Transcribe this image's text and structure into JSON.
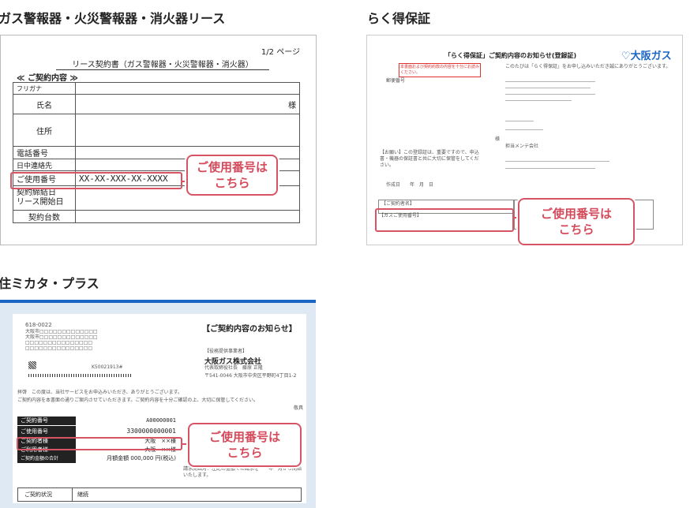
{
  "sections": {
    "gas": {
      "title": "ガス警報器・火災警報器・消火器リース",
      "page": "1/2 ページ",
      "doc_title": "リース契約書（ガス警報器・火災警報器・消火器）",
      "contract_heading": "≪ ご契約内容 ≫",
      "rows": [
        {
          "label": "フリガナ",
          "value": ""
        },
        {
          "label": "氏名",
          "value": "様"
        },
        {
          "label": "住所",
          "value": ""
        },
        {
          "label": "電話番号",
          "value": ""
        },
        {
          "label": "日中連絡先",
          "value": ""
        },
        {
          "label": "ご使用番号",
          "value": "XX-XX-XXX-XX-XXXX"
        },
        {
          "label": "契約締結日\nリース開始日",
          "value": ""
        },
        {
          "label": "契約台数",
          "value": ""
        }
      ],
      "callout": [
        "ご使用番号は",
        "こちら"
      ]
    },
    "raku": {
      "title": "らく得保証",
      "doc_title": "「らく得保証」ご契約内容のお知らせ(登録証)",
      "brand": "大阪ガス",
      "notice": "本書面および契約約款の内容を十分にお読みください。",
      "postal_label": "郵便番号",
      "body_text": "このたびは「らく得保証」をお申し込みいただき誠にありがとうございます。",
      "left_block": "【お願い】この登録証は、重要ですので、申込書・機器の保証書と共に大切に保管をしてください。",
      "date_label": "作成日　　年　月　日",
      "contractor_label": "【ご契約者名】",
      "usage_label": "【ガスご使用番号】",
      "sama": "様",
      "tanto": "担当メンテ会社",
      "callout": [
        "ご使用番号は",
        "こちら"
      ]
    },
    "sumi": {
      "title": "住ミカタ・プラス",
      "postal": "618-0022",
      "doc_title": "【ご契約内容のお知らせ】",
      "provider_label": "【役務提供事業者】",
      "company": "大阪ガス株式会社",
      "rep": "代表取締役社長　藤原 正隆",
      "address": "〒541-0046 大阪市中央区平野町4丁目1-2",
      "barcode_code": "K50021913#",
      "greeting1": "拝啓　この度は、当社サービスをお申込みいただき、ありがとうございます。",
      "greeting2": "ご契約内容を本書面の通りご案内させていただきます。ご契約内容を十分ご確認の上、大切に保管してください。",
      "keigu": "敬具",
      "rows": [
        {
          "label": "ご契約番号",
          "value": "A00000001"
        },
        {
          "label": "ご使用番号",
          "value": "3300000000001"
        },
        {
          "label": "ご契約者様",
          "value": "大阪　××様"
        },
        {
          "label": "ご利用者様",
          "value": "大阪　××様"
        },
        {
          "label": "ご契約金額の合計",
          "value": "月額金額 000,000 円(税込)"
        }
      ],
      "billing": "請求開始月：左記の金額での請求を　　年　月から開始いたします。",
      "status_label": "ご契約状況",
      "status_value": "継続",
      "callout": [
        "ご使用番号は",
        "こちら"
      ]
    }
  }
}
